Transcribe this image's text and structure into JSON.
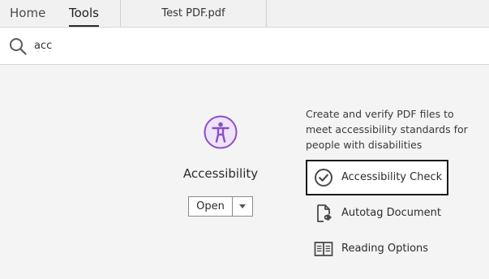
{
  "tabs": {
    "home": "Home",
    "tools": "Tools",
    "document": "Test PDF.pdf"
  },
  "search": {
    "value": "acc",
    "icon": "search-icon"
  },
  "tool": {
    "name": "Accessibility",
    "icon": "accessibility-icon",
    "icon_color": "#8a4fc7",
    "open_label": "Open"
  },
  "details": {
    "description": "Create and verify PDF files to meet accessibility standards for people with disabilities",
    "actions": [
      {
        "label": "Accessibility Check",
        "icon": "check-circle-icon"
      },
      {
        "label": "Autotag Document",
        "icon": "tag-document-icon"
      },
      {
        "label": "Reading Options",
        "icon": "book-icon"
      }
    ]
  }
}
